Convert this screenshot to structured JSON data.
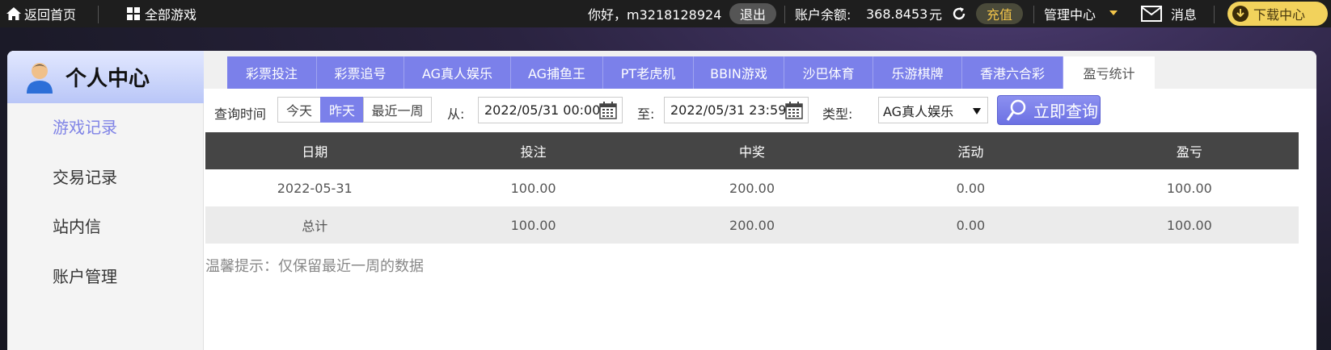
{
  "topbar": {
    "home": "返回首页",
    "all_games": "全部游戏",
    "greeting": "你好，m3218128924",
    "logout": "退出",
    "balance_label": "账户余额:",
    "balance_value": "368.8453",
    "balance_unit": "元",
    "recharge": "充值",
    "manage": "管理中心",
    "messages": "消息",
    "download": "下载中心"
  },
  "sidebar": {
    "title": "个人中心",
    "items": [
      {
        "label": "游戏记录"
      },
      {
        "label": "交易记录"
      },
      {
        "label": "站内信"
      },
      {
        "label": "账户管理"
      }
    ]
  },
  "tabs": [
    {
      "label": "彩票投注"
    },
    {
      "label": "彩票追号"
    },
    {
      "label": "AG真人娱乐"
    },
    {
      "label": "AG捕鱼王"
    },
    {
      "label": "PT老虎机"
    },
    {
      "label": "BBIN游戏"
    },
    {
      "label": "沙巴体育"
    },
    {
      "label": "乐游棋牌"
    },
    {
      "label": "香港六合彩"
    },
    {
      "label": "盈亏统计"
    }
  ],
  "filter": {
    "query_time_label": "查询时间",
    "today": "今天",
    "yesterday": "昨天",
    "last_week": "最近一周",
    "from_label": "从:",
    "from_value": "2022/05/31 00:00",
    "to_label": "至:",
    "to_value": "2022/05/31 23:59",
    "type_label": "类型:",
    "type_value": "AG真人娱乐",
    "query_button": "立即查询"
  },
  "table": {
    "headers": [
      "日期",
      "投注",
      "中奖",
      "活动",
      "盈亏"
    ],
    "rows": [
      [
        "2022-05-31",
        "100.00",
        "200.00",
        "0.00",
        "100.00"
      ],
      [
        "总计",
        "100.00",
        "200.00",
        "0.00",
        "100.00"
      ]
    ]
  },
  "tip": "温馨提示：仅保留最近一周的数据",
  "colors": {
    "accent": "#7b80ea",
    "balance": "#f2c54a",
    "header_bg": "#454545"
  }
}
